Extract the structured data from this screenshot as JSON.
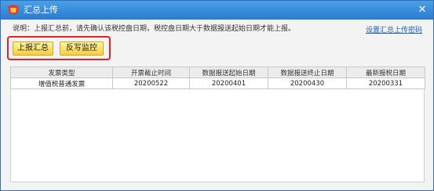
{
  "window": {
    "title": "汇总上传",
    "close_glyph": "✕"
  },
  "instruction": "说明：上报汇总前，请先确认该税控盘日期，税控盘日期大于数据报送起始日期才能上报。",
  "password_link": "设置汇总上传密码",
  "buttons": {
    "upload_summary": "上报汇总",
    "write_back_monitor": "反写监控"
  },
  "table": {
    "headers": [
      "发票类型",
      "开票截止时间",
      "数据报送起始日期",
      "数据报送终止日期",
      "最新报税日期"
    ],
    "rows": [
      [
        "增值税普通发票",
        "20200522",
        "20200401",
        "20200430",
        "20200331"
      ]
    ]
  },
  "colors": {
    "titlebar": "#2b7bd0",
    "highlight_border": "#e0222b",
    "button_fill": "#f7cf3c"
  }
}
